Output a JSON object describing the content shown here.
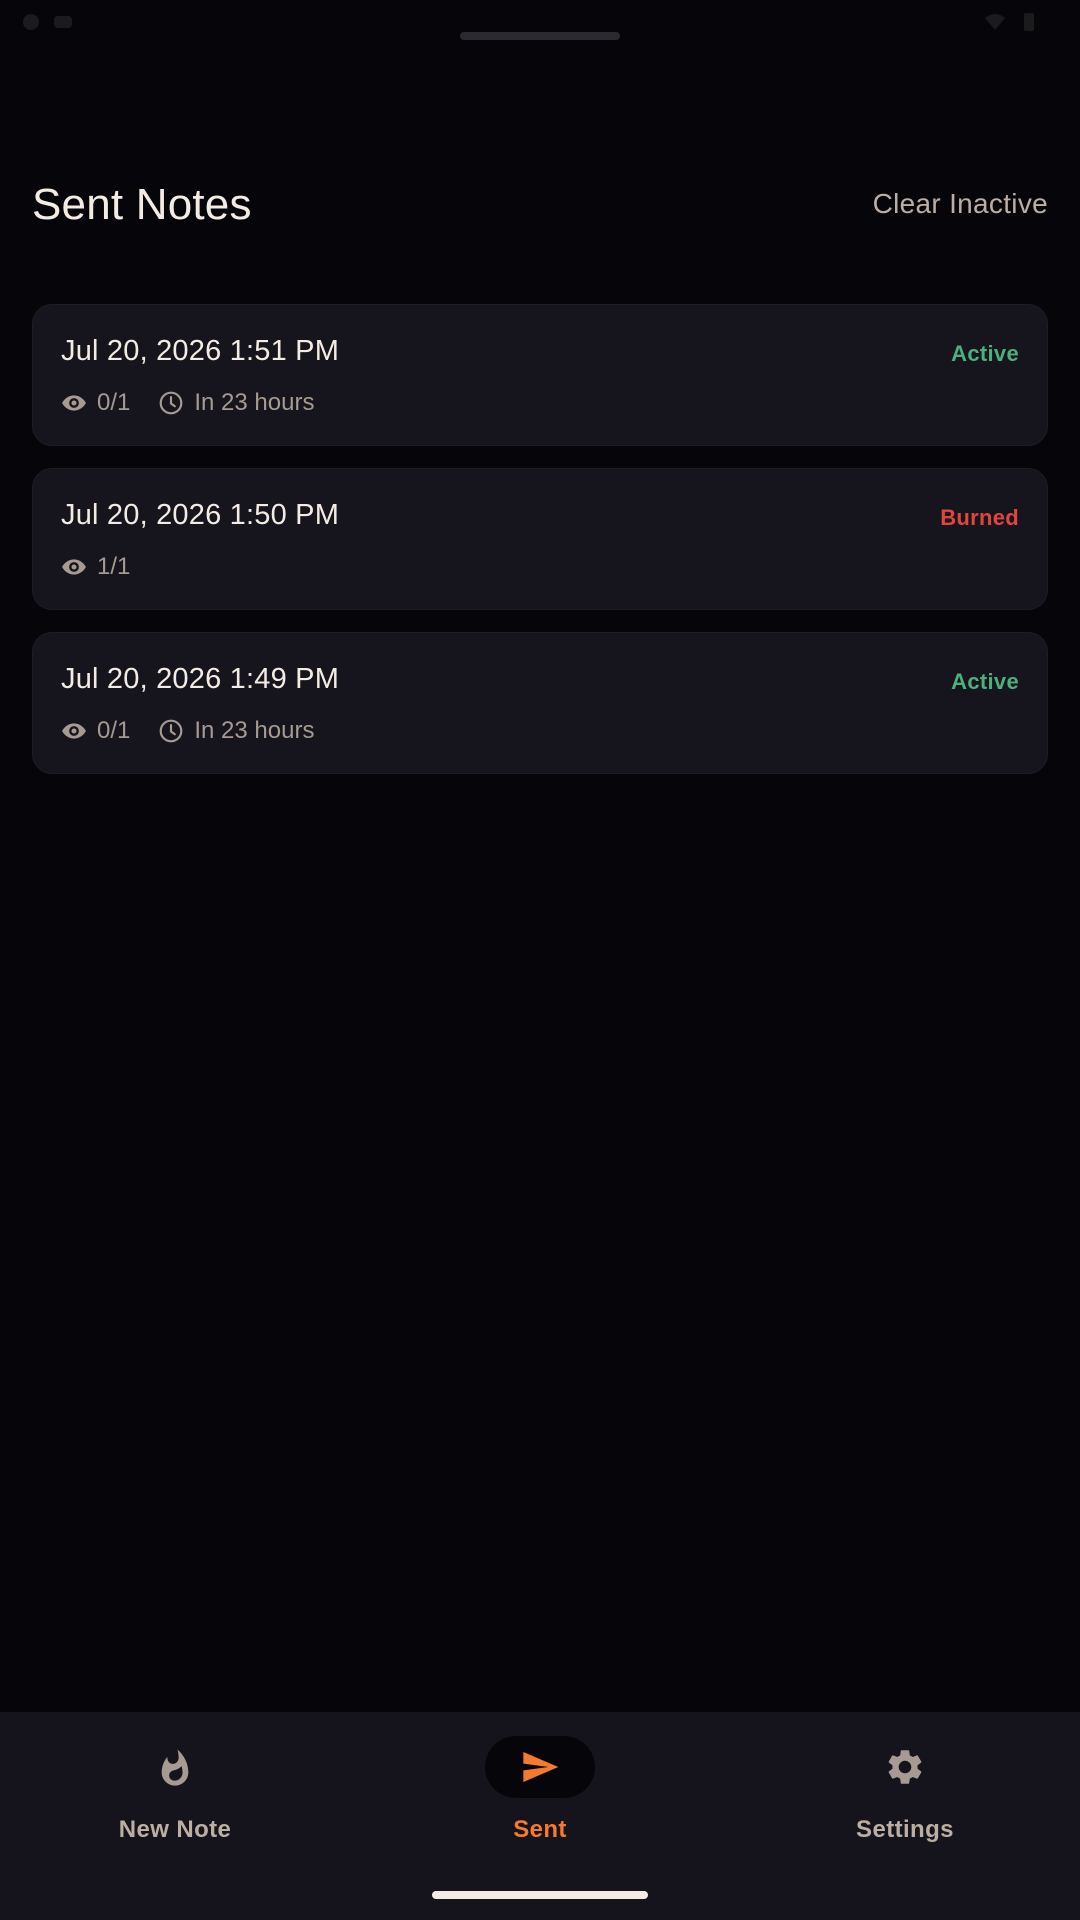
{
  "header": {
    "title": "Sent Notes",
    "clear_label": "Clear Inactive"
  },
  "notes": [
    {
      "date": "Jul 20, 2026 1:51 PM",
      "status": "Active",
      "views": "0/1",
      "expires": "In 23 hours"
    },
    {
      "date": "Jul 20, 2026 1:50 PM",
      "status": "Burned",
      "views": "1/1"
    },
    {
      "date": "Jul 20, 2026 1:49 PM",
      "status": "Active",
      "views": "0/1",
      "expires": "In 23 hours"
    }
  ],
  "nav": {
    "items": [
      {
        "label": "New Note",
        "icon": "flame-icon"
      },
      {
        "label": "Sent",
        "icon": "send-icon",
        "active": true
      },
      {
        "label": "Settings",
        "icon": "gear-icon"
      }
    ]
  },
  "colors": {
    "accent": "#f47a2e",
    "active_status": "#4caf7d",
    "burned_status": "#e0453e",
    "background": "#06050a",
    "card": "#16151d"
  }
}
